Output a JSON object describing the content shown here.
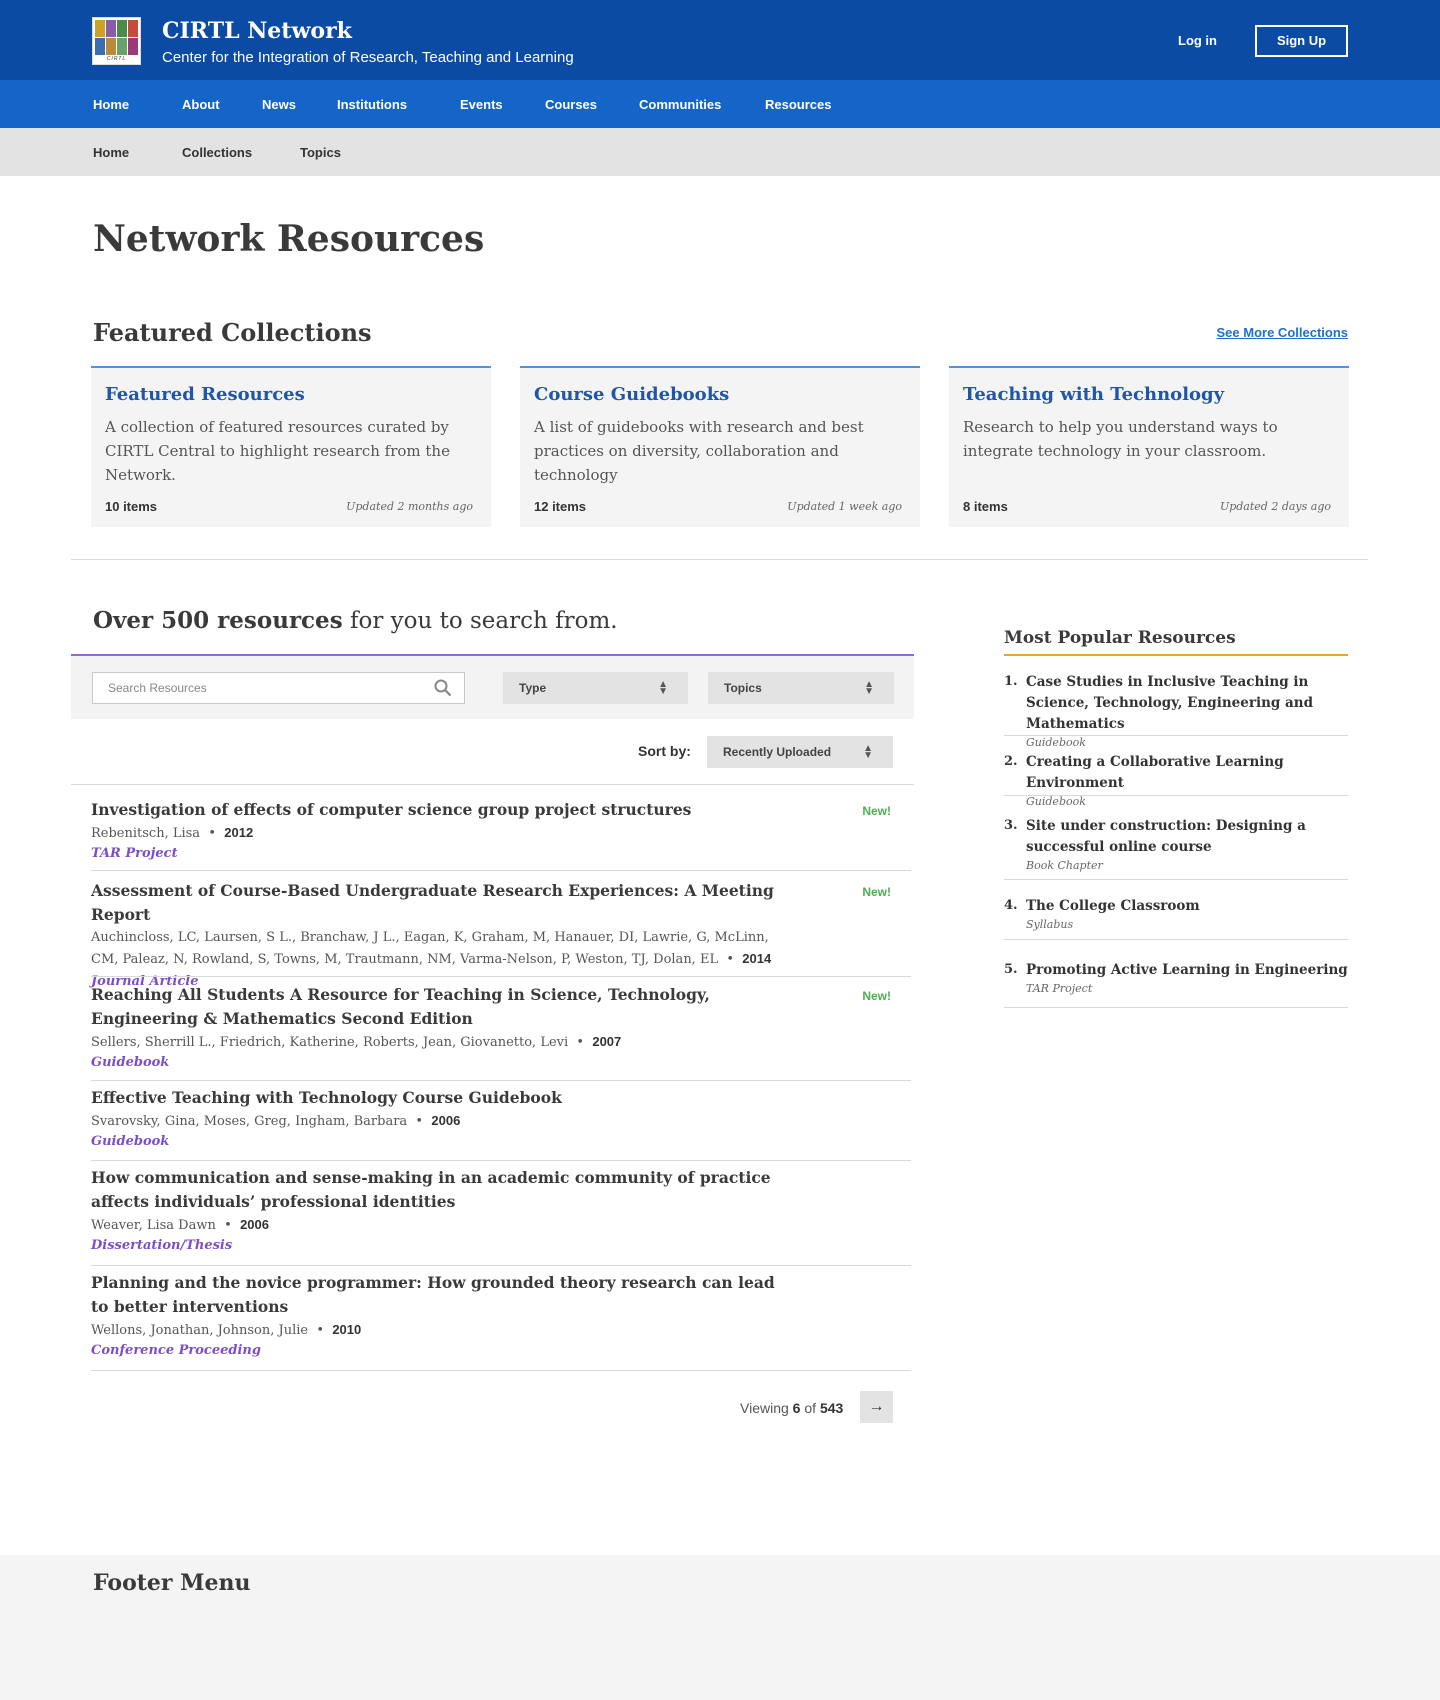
{
  "header": {
    "logo_text": "CIRTL",
    "title": "CIRTL Network",
    "subtitle": "Center for the Integration of Research, Teaching and Learning",
    "login": "Log in",
    "signup": "Sign Up",
    "brand_color": "#0b4ba3"
  },
  "main_nav": [
    "Home",
    "About",
    "News",
    "Institutions",
    "Events",
    "Courses",
    "Communities",
    "Resources"
  ],
  "sub_nav": [
    "Home",
    "Collections",
    "Topics"
  ],
  "page_title": "Network Resources",
  "featured": {
    "title": "Featured Collections",
    "see_more": "See More Collections",
    "cards": [
      {
        "title": "Featured Resources",
        "desc": "A collection of featured resources curated by CIRTL Central to highlight research from the Network.",
        "count": "10 items",
        "updated": "Updated 2 months ago"
      },
      {
        "title": "Course Guidebooks",
        "desc": "A list of guidebooks with research and best practices on diversity, collaboration and technology",
        "count": "12 items",
        "updated": "Updated 1 week ago"
      },
      {
        "title": "Teaching with Technology",
        "desc": "Research to help you understand ways to integrate technology in your classroom.",
        "count": "8 items",
        "updated": "Updated 2 days ago"
      }
    ]
  },
  "search": {
    "headline_bold": "Over 500 resources",
    "headline_rest": " for you to search from.",
    "placeholder": "Search Resources",
    "type_label": "Type",
    "topics_label": "Topics",
    "sort_label": "Sort by:",
    "sort_value": "Recently Uploaded"
  },
  "results": [
    {
      "title": "Investigation of effects of computer science group project structures",
      "authors": "Rebenitsch, Lisa",
      "year": "2012",
      "type": "TAR Project",
      "new": "New!"
    },
    {
      "title": "Assessment of Course-Based Undergraduate Research Experiences: A Meeting Report",
      "authors": "Auchincloss, LC, Laursen, S L., Branchaw, J L., Eagan, K, Graham, M, Hanauer, DI, Lawrie, G, McLinn, CM, Paleaz, N, Rowland, S, Towns, M, Trautmann, NM, Varma-Nelson, P, Weston, TJ, Dolan, EL",
      "year": "2014",
      "type": "Journal Article",
      "new": "New!"
    },
    {
      "title": "Reaching All Students A Resource for Teaching in Science, Technology, Engineering & Mathematics Second Edition",
      "authors": "Sellers, Sherrill L., Friedrich, Katherine, Roberts, Jean, Giovanetto, Levi",
      "year": "2007",
      "type": "Guidebook",
      "new": "New!"
    },
    {
      "title": "Effective Teaching with Technology Course Guidebook",
      "authors": "Svarovsky, Gina, Moses, Greg, Ingham, Barbara",
      "year": "2006",
      "type": "Guidebook",
      "new": ""
    },
    {
      "title": "How communication and sense-making in an academic community of practice affects individuals’ professional identities",
      "authors": "Weaver, Lisa Dawn",
      "year": "2006",
      "type": "Dissertation/Thesis",
      "new": ""
    },
    {
      "title": "Planning and the novice programmer: How grounded theory research can lead to better interventions",
      "authors": "Wellons, Jonathan, Johnson, Julie",
      "year": "2010",
      "type": "Conference Proceeding",
      "new": ""
    }
  ],
  "pagination": {
    "viewing_label": "Viewing",
    "count": "6",
    "of_label": "of",
    "total": "543",
    "next": "→"
  },
  "popular": {
    "title": "Most Popular Resources",
    "items": [
      {
        "num": "1.",
        "title": "Case Studies in Inclusive Teaching in Science, Technology, Engineering and Mathematics",
        "type": "Guidebook"
      },
      {
        "num": "2.",
        "title": "Creating a Collaborative Learning Environment",
        "type": "Guidebook"
      },
      {
        "num": "3.",
        "title": "Site under construction: Designing a successful online course",
        "type": "Book Chapter"
      },
      {
        "num": "4.",
        "title": "The College Classroom",
        "type": "Syllabus"
      },
      {
        "num": "5.",
        "title": "Promoting Active Learning in Engineering",
        "type": "TAR Project"
      }
    ]
  },
  "footer": {
    "title": "Footer Menu"
  }
}
